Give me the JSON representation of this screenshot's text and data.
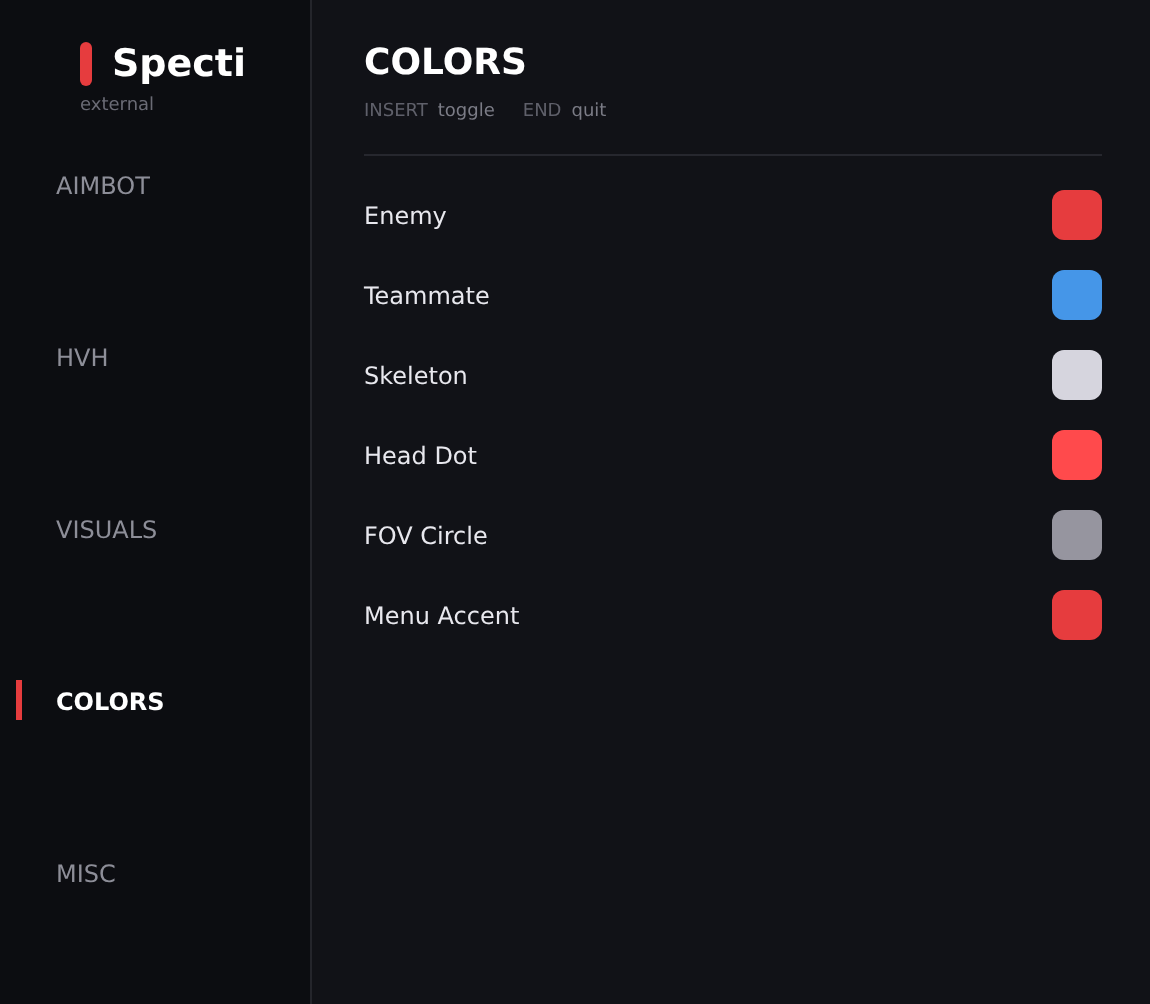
{
  "brand": {
    "name": "Specti",
    "subtitle": "external"
  },
  "sidebar": {
    "items": [
      {
        "label": "AIMBOT",
        "selected": false
      },
      {
        "label": "HVH",
        "selected": false
      },
      {
        "label": "VISUALS",
        "selected": false
      },
      {
        "label": "COLORS",
        "selected": true
      },
      {
        "label": "MISC",
        "selected": false
      }
    ]
  },
  "header": {
    "title": "COLORS",
    "hints": [
      {
        "key": "INSERT",
        "action": "toggle"
      },
      {
        "key": "END",
        "action": "quit"
      }
    ]
  },
  "colors": [
    {
      "label": "Enemy",
      "color": "#e63c3e"
    },
    {
      "label": "Teammate",
      "color": "#4596e8"
    },
    {
      "label": "Skeleton",
      "color": "#d6d5de"
    },
    {
      "label": "Head Dot",
      "color": "#ff4a4c"
    },
    {
      "label": "FOV Circle",
      "color": "#96959f"
    },
    {
      "label": "Menu Accent",
      "color": "#e63c3e"
    }
  ]
}
